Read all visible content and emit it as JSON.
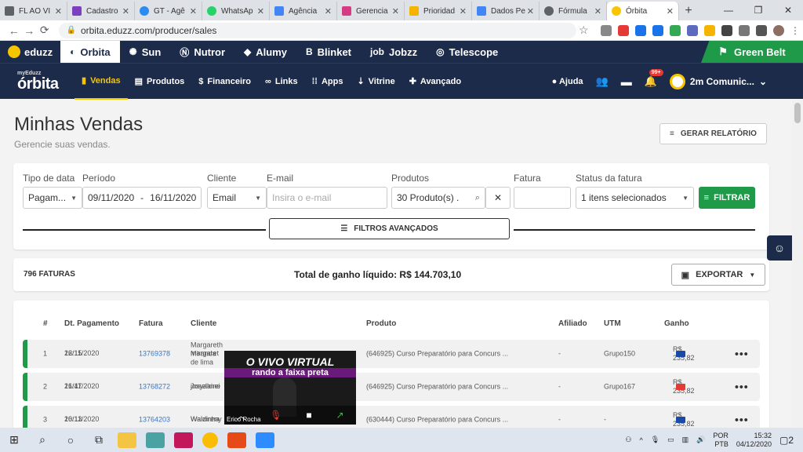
{
  "browser": {
    "tabs": [
      {
        "label": "FL AO VI",
        "color": "#5f6368"
      },
      {
        "label": "Cadastro",
        "color": "#7b3fbf"
      },
      {
        "label": "GT - Agê",
        "color": "#2d8cf0"
      },
      {
        "label": "WhatsAp",
        "color": "#25d366"
      },
      {
        "label": "Agência",
        "color": "#4285f4"
      },
      {
        "label": "Gerencia",
        "color": "#d63c83"
      },
      {
        "label": "Prioridad",
        "color": "#f4b400"
      },
      {
        "label": "Dados Pe",
        "color": "#4285f4"
      },
      {
        "label": "Fórmula",
        "color": "#5f6368"
      },
      {
        "label": "Órbita",
        "color": "#f7c600"
      }
    ],
    "url": "orbita.eduzz.com/producer/sales"
  },
  "topbar": {
    "brand": "eduzz",
    "items": [
      "Orbita",
      "Sun",
      "Nutror",
      "Alumy",
      "Blinket",
      "Jobzz",
      "Telescope"
    ],
    "greenbelt": "Green Belt"
  },
  "orbnav": {
    "logo_small": "myEduzz",
    "logo_big": "órbita",
    "items": [
      "Vendas",
      "Produtos",
      "Financeiro",
      "Links",
      "Apps",
      "Vitrine",
      "Avançado"
    ],
    "help": "Ajuda",
    "notifications": "99+",
    "account": "2m Comunic..."
  },
  "page": {
    "title": "Minhas Vendas",
    "subtitle": "Gerencie suas vendas.",
    "report_button": "GERAR RELATÓRIO"
  },
  "filters": {
    "labels": {
      "tipo": "Tipo de data",
      "periodo": "Período",
      "cliente": "Cliente",
      "email": "E-mail",
      "produtos": "Produtos",
      "fatura": "Fatura",
      "status": "Status da fatura"
    },
    "tipo_value": "Pagam...",
    "period_from": "09/11/2020",
    "period_sep": "-",
    "period_to": "16/11/2020",
    "cliente_value": "Email",
    "email_placeholder": "Insira o e-mail",
    "produtos_value": "30 Produto(s) .",
    "status_value": "1 itens selecionados",
    "filter_button": "FILTRAR",
    "advanced_button": "FILTROS AVANÇADOS"
  },
  "summary": {
    "count": "796 FATURAS",
    "total": "Total de ganho líquido: R$ 144.703,10",
    "export_button": "EXPORTAR"
  },
  "table": {
    "headers": [
      "#",
      "Dt. Pagamento",
      "Fatura",
      "Cliente",
      "Produto",
      "Afiliado",
      "UTM",
      "Ganho"
    ],
    "rows": [
      {
        "n": "1",
        "date": "16/11/2020",
        "time": "22:15",
        "fatura": "13769378",
        "cliente1": "Margareth Miranda de lima",
        "cliente2": "margaret",
        "produto": "(646925) Curso Preparatório para Concurs ...",
        "afiliado": "-",
        "utm": "Grupo150",
        "ganho": "R$ 235,82",
        "card_color": "#1a4aa8"
      },
      {
        "n": "2",
        "date": "16/11/2020",
        "time": "21:47",
        "fatura": "13768272",
        "cliente1": "Joselaine",
        "cliente2": "josyalmei",
        "produto": "(646925) Curso Preparatório para Concurs ...",
        "afiliado": "-",
        "utm": "Grupo167",
        "ganho": "R$ 235,82",
        "card_color": "#e53935"
      },
      {
        "n": "3",
        "date": "16/11/2020",
        "time": "20:13",
        "fatura": "13764203",
        "cliente1": "Waldireny",
        "cliente2": "Walzinha",
        "produto": "(630444) Curso Preparatório para Concurs ...",
        "afiliado": "-",
        "utm": "-",
        "ganho": "R$ 235,82",
        "card_color": "#1a4aa8"
      }
    ],
    "actions": "•••"
  },
  "video": {
    "line1": "O VIVO VIRTUAL",
    "line2": "rando a faixa preta",
    "name": "Erico Rocha"
  },
  "taskbar": {
    "lang1": "POR",
    "lang2": "PTB",
    "time": "15:32",
    "date": "04/12/2020",
    "notif": "2"
  }
}
